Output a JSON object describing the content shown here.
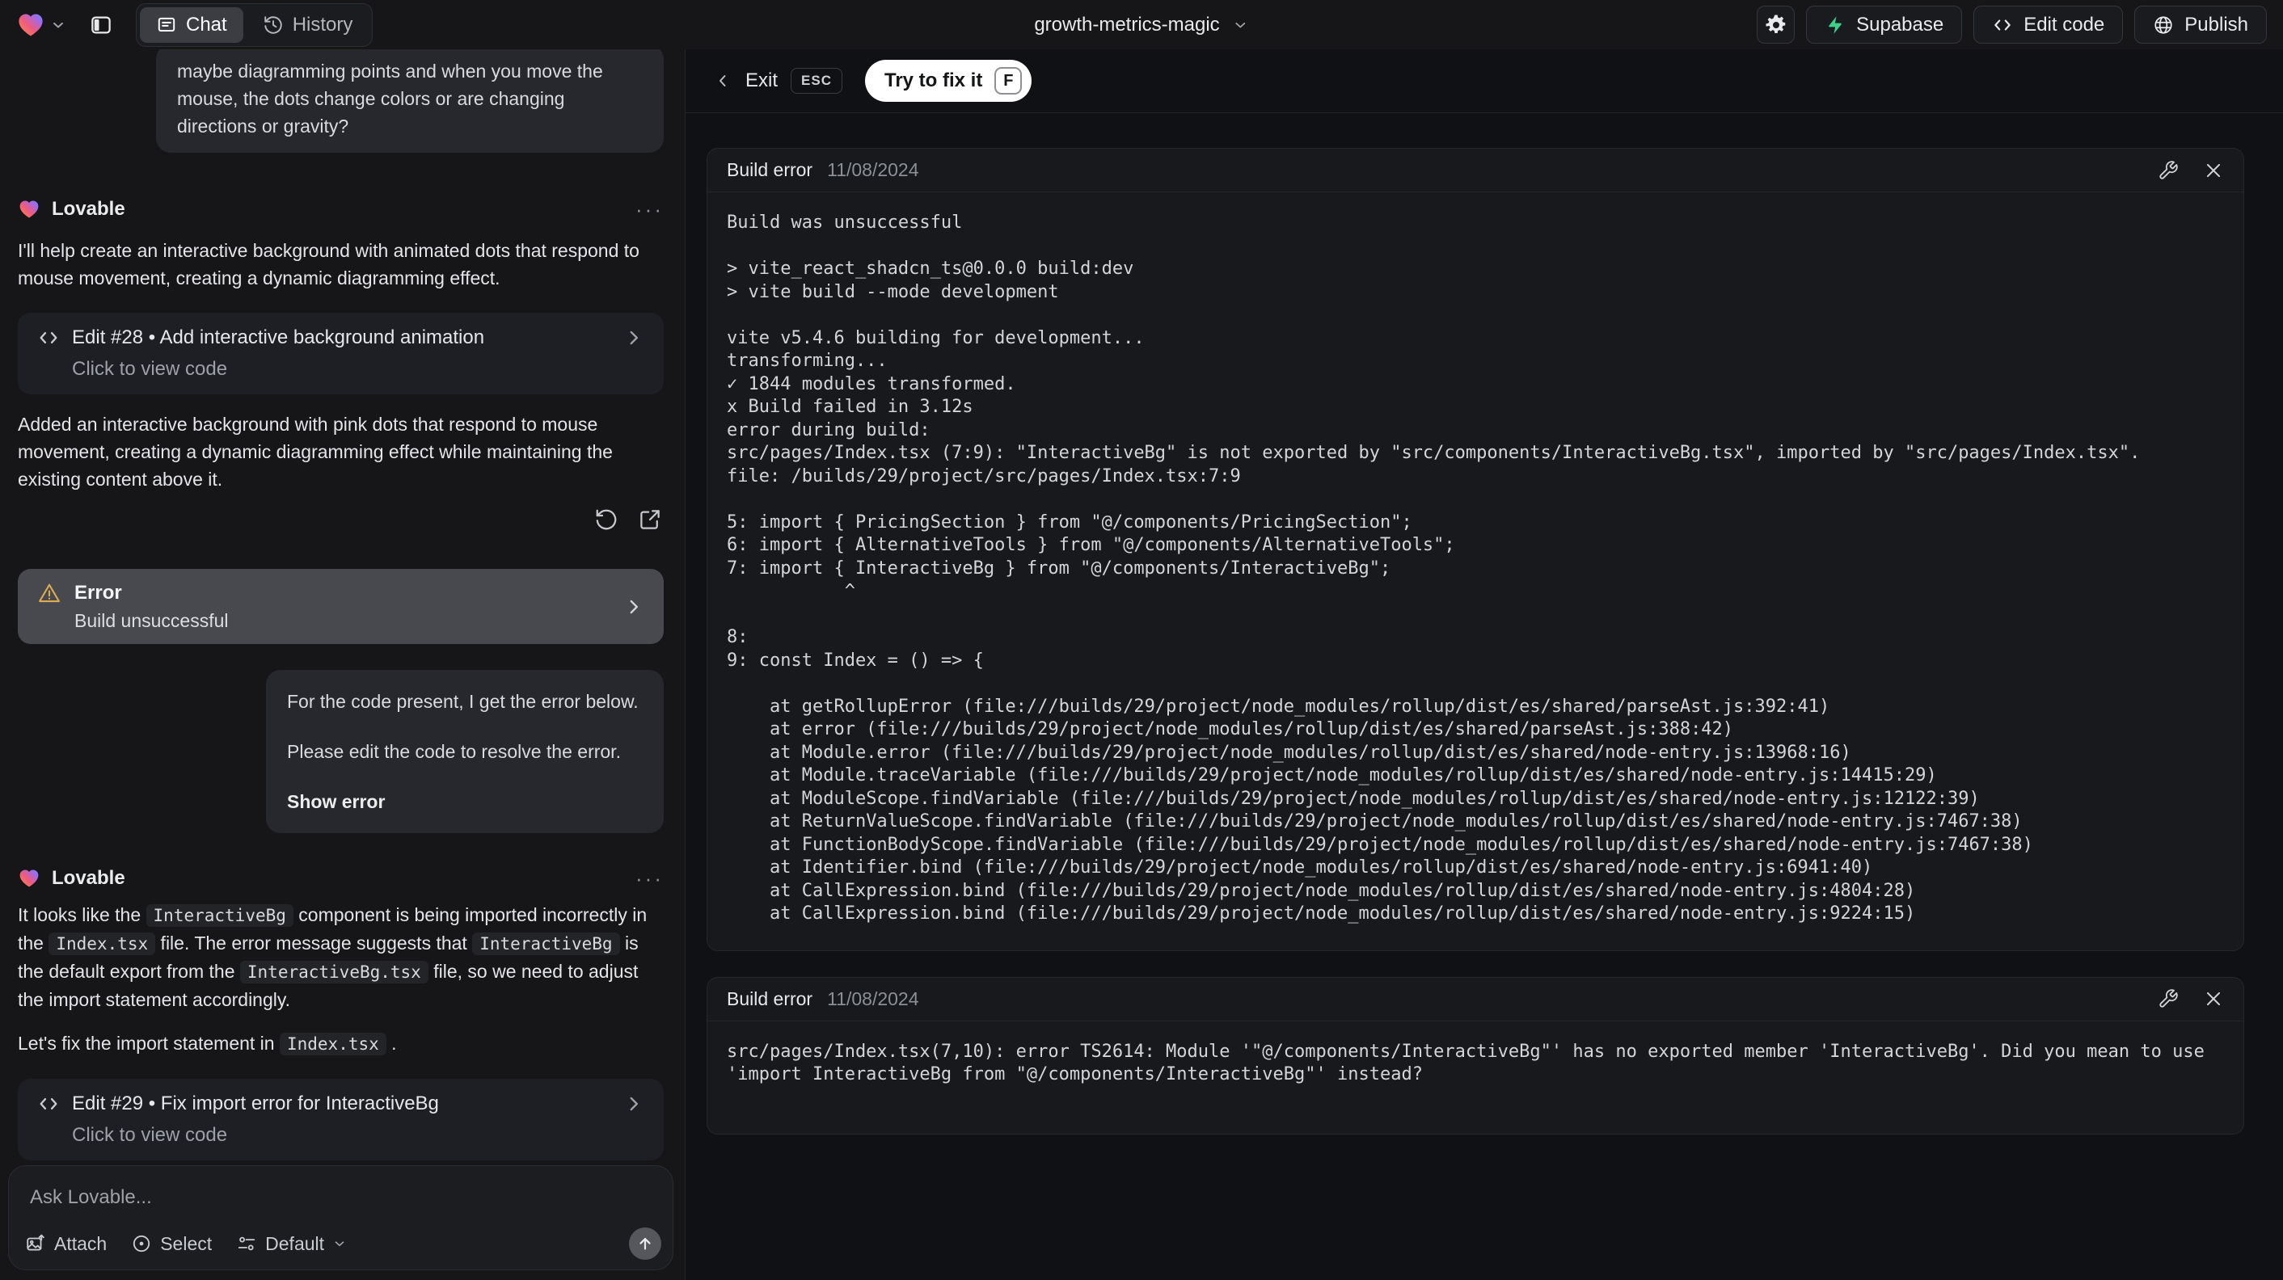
{
  "topbar": {
    "project_name": "growth-metrics-magic",
    "tabs": [
      {
        "label": "Chat"
      },
      {
        "label": "History"
      }
    ],
    "supabase_label": "Supabase",
    "edit_code_label": "Edit code",
    "publish_label": "Publish"
  },
  "chat": {
    "assistant_name": "Lovable",
    "menu_dots": "···",
    "user_message_1": "maybe diagramming points and when you move the mouse, the dots change colors or are changing directions or gravity?",
    "assistant_message_1": "I'll help create an interactive background with animated dots that respond to mouse movement, creating a dynamic diagramming effect.",
    "edit_card_28": {
      "title": "Edit #28 • Add interactive background animation",
      "subtitle": "Click to view code"
    },
    "assistant_message_2": "Added an interactive background with pink dots that respond to mouse movement, creating a dynamic diagramming effect while maintaining the existing content above it.",
    "error_card": {
      "title": "Error",
      "subtitle": "Build unsuccessful"
    },
    "user_message_2": {
      "line1": "For the code present, I get the error below.",
      "line2": "Please edit the code to resolve the error.",
      "action": "Show error"
    },
    "assistant_message_3_segments": [
      {
        "t": "text",
        "v": "It looks like the "
      },
      {
        "t": "code",
        "v": "InteractiveBg"
      },
      {
        "t": "text",
        "v": " component is being imported incorrectly in the "
      },
      {
        "t": "code",
        "v": "Index.tsx"
      },
      {
        "t": "text",
        "v": " file. The error message suggests that "
      },
      {
        "t": "code",
        "v": "InteractiveBg"
      },
      {
        "t": "text",
        "v": " is the default export from the "
      },
      {
        "t": "code",
        "v": "InteractiveBg.tsx"
      },
      {
        "t": "text",
        "v": " file, so we need to adjust the import statement accordingly."
      }
    ],
    "assistant_message_4_segments": [
      {
        "t": "text",
        "v": "Let's fix the import statement in "
      },
      {
        "t": "code",
        "v": "Index.tsx"
      },
      {
        "t": "text",
        "v": " ."
      }
    ],
    "edit_card_29": {
      "title": "Edit #29 • Fix import error for InteractiveBg",
      "subtitle": "Click to view code"
    },
    "composer": {
      "placeholder": "Ask Lovable...",
      "attach_label": "Attach",
      "select_label": "Select",
      "model_label": "Default",
      "send_arrow": "↑"
    }
  },
  "error_panel": {
    "exit_label": "Exit",
    "esc_key": "ESC",
    "fix_label": "Try to fix it",
    "fix_key": "F",
    "cards": [
      {
        "title": "Build error",
        "date": "11/08/2024",
        "log": "Build was unsuccessful\n\n> vite_react_shadcn_ts@0.0.0 build:dev\n> vite build --mode development\n\nvite v5.4.6 building for development...\ntransforming...\n✓ 1844 modules transformed.\nx Build failed in 3.12s\nerror during build:\nsrc/pages/Index.tsx (7:9): \"InteractiveBg\" is not exported by \"src/components/InteractiveBg.tsx\", imported by \"src/pages/Index.tsx\".\nfile: /builds/29/project/src/pages/Index.tsx:7:9\n\n5: import { PricingSection } from \"@/components/PricingSection\";\n6: import { AlternativeTools } from \"@/components/AlternativeTools\";\n7: import { InteractiveBg } from \"@/components/InteractiveBg\";\n           ^\n\n8: \n9: const Index = () => {\n\n    at getRollupError (file:///builds/29/project/node_modules/rollup/dist/es/shared/parseAst.js:392:41)\n    at error (file:///builds/29/project/node_modules/rollup/dist/es/shared/parseAst.js:388:42)\n    at Module.error (file:///builds/29/project/node_modules/rollup/dist/es/shared/node-entry.js:13968:16)\n    at Module.traceVariable (file:///builds/29/project/node_modules/rollup/dist/es/shared/node-entry.js:14415:29)\n    at ModuleScope.findVariable (file:///builds/29/project/node_modules/rollup/dist/es/shared/node-entry.js:12122:39)\n    at ReturnValueScope.findVariable (file:///builds/29/project/node_modules/rollup/dist/es/shared/node-entry.js:7467:38)\n    at FunctionBodyScope.findVariable (file:///builds/29/project/node_modules/rollup/dist/es/shared/node-entry.js:7467:38)\n    at Identifier.bind (file:///builds/29/project/node_modules/rollup/dist/es/shared/node-entry.js:6941:40)\n    at CallExpression.bind (file:///builds/29/project/node_modules/rollup/dist/es/shared/node-entry.js:4804:28)\n    at CallExpression.bind (file:///builds/29/project/node_modules/rollup/dist/es/shared/node-entry.js:9224:15)"
      },
      {
        "title": "Build error",
        "date": "11/08/2024",
        "log": "src/pages/Index.tsx(7,10): error TS2614: Module '\"@/components/InteractiveBg\"' has no exported member 'InteractiveBg'. Did you mean to use 'import InteractiveBg from \"@/components/InteractiveBg\"' instead?"
      }
    ]
  },
  "colors": {
    "supabase_green": "#3ecf8e",
    "warning_amber": "#dcab52",
    "fix_button_bg": "#ffffff",
    "sidebar_bg": "#161619",
    "panel_bg": "#101114"
  }
}
